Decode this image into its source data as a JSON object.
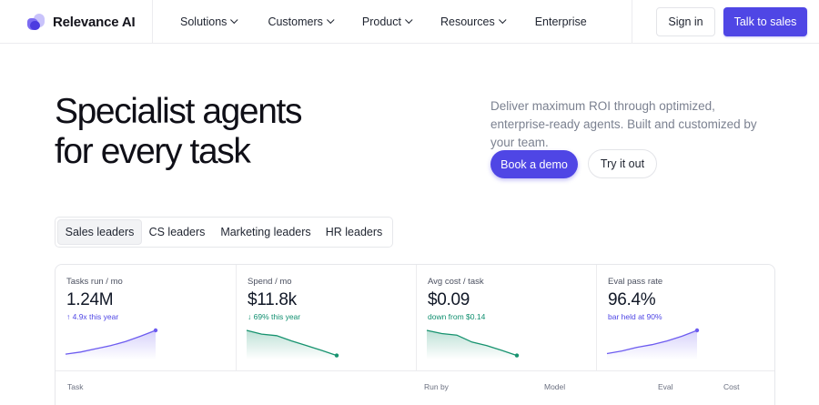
{
  "nav": {
    "brand": "Relevance AI",
    "menu": [
      {
        "label": "Solutions",
        "has_dropdown": true
      },
      {
        "label": "Customers",
        "has_dropdown": true
      },
      {
        "label": "Product",
        "has_dropdown": true
      },
      {
        "label": "Resources",
        "has_dropdown": true
      },
      {
        "label": "Enterprise",
        "has_dropdown": false
      }
    ],
    "sign_in": "Sign in",
    "talk_to_sales": "Talk to sales"
  },
  "hero": {
    "headline_line1": "Specialist agents",
    "headline_line2": "for every task",
    "subcopy": "Deliver maximum ROI through optimized, enterprise-ready agents. Built and customized by your team.",
    "cta_primary": "Book a demo",
    "cta_secondary": "Try it out"
  },
  "tabs": [
    {
      "label": "Sales leaders",
      "active": true
    },
    {
      "label": "CS leaders",
      "active": false
    },
    {
      "label": "Marketing leaders",
      "active": false
    },
    {
      "label": "HR leaders",
      "active": false
    }
  ],
  "metrics": [
    {
      "label": "Tasks run / mo",
      "value": "1.24M",
      "note": "↑ 4.9x this year",
      "trend": "up",
      "spark": [
        0.1,
        0.18,
        0.3,
        0.42,
        0.58,
        0.78,
        1.0
      ]
    },
    {
      "label": "Spend / mo",
      "value": "$11.8k",
      "note": "↓ 69% this year",
      "trend": "down",
      "spark": [
        1.0,
        0.86,
        0.8,
        0.6,
        0.42,
        0.24,
        0.05
      ]
    },
    {
      "label": "Avg cost / task",
      "value": "$0.09",
      "note": "down from $0.14",
      "trend": "down",
      "spark": [
        1.0,
        0.88,
        0.82,
        0.56,
        0.42,
        0.24,
        0.05
      ]
    },
    {
      "label": "Eval pass rate",
      "value": "96.4%",
      "note": "bar held at 90%",
      "trend": "up",
      "spark": [
        0.12,
        0.22,
        0.36,
        0.46,
        0.6,
        0.78,
        1.0
      ]
    }
  ],
  "table": {
    "headers": [
      "Task",
      "Run by",
      "Model",
      "Eval",
      "Cost"
    ]
  },
  "colors": {
    "accent": "#4f46e5",
    "up_line": "#6d5cf0",
    "down_line": "#17936f"
  }
}
